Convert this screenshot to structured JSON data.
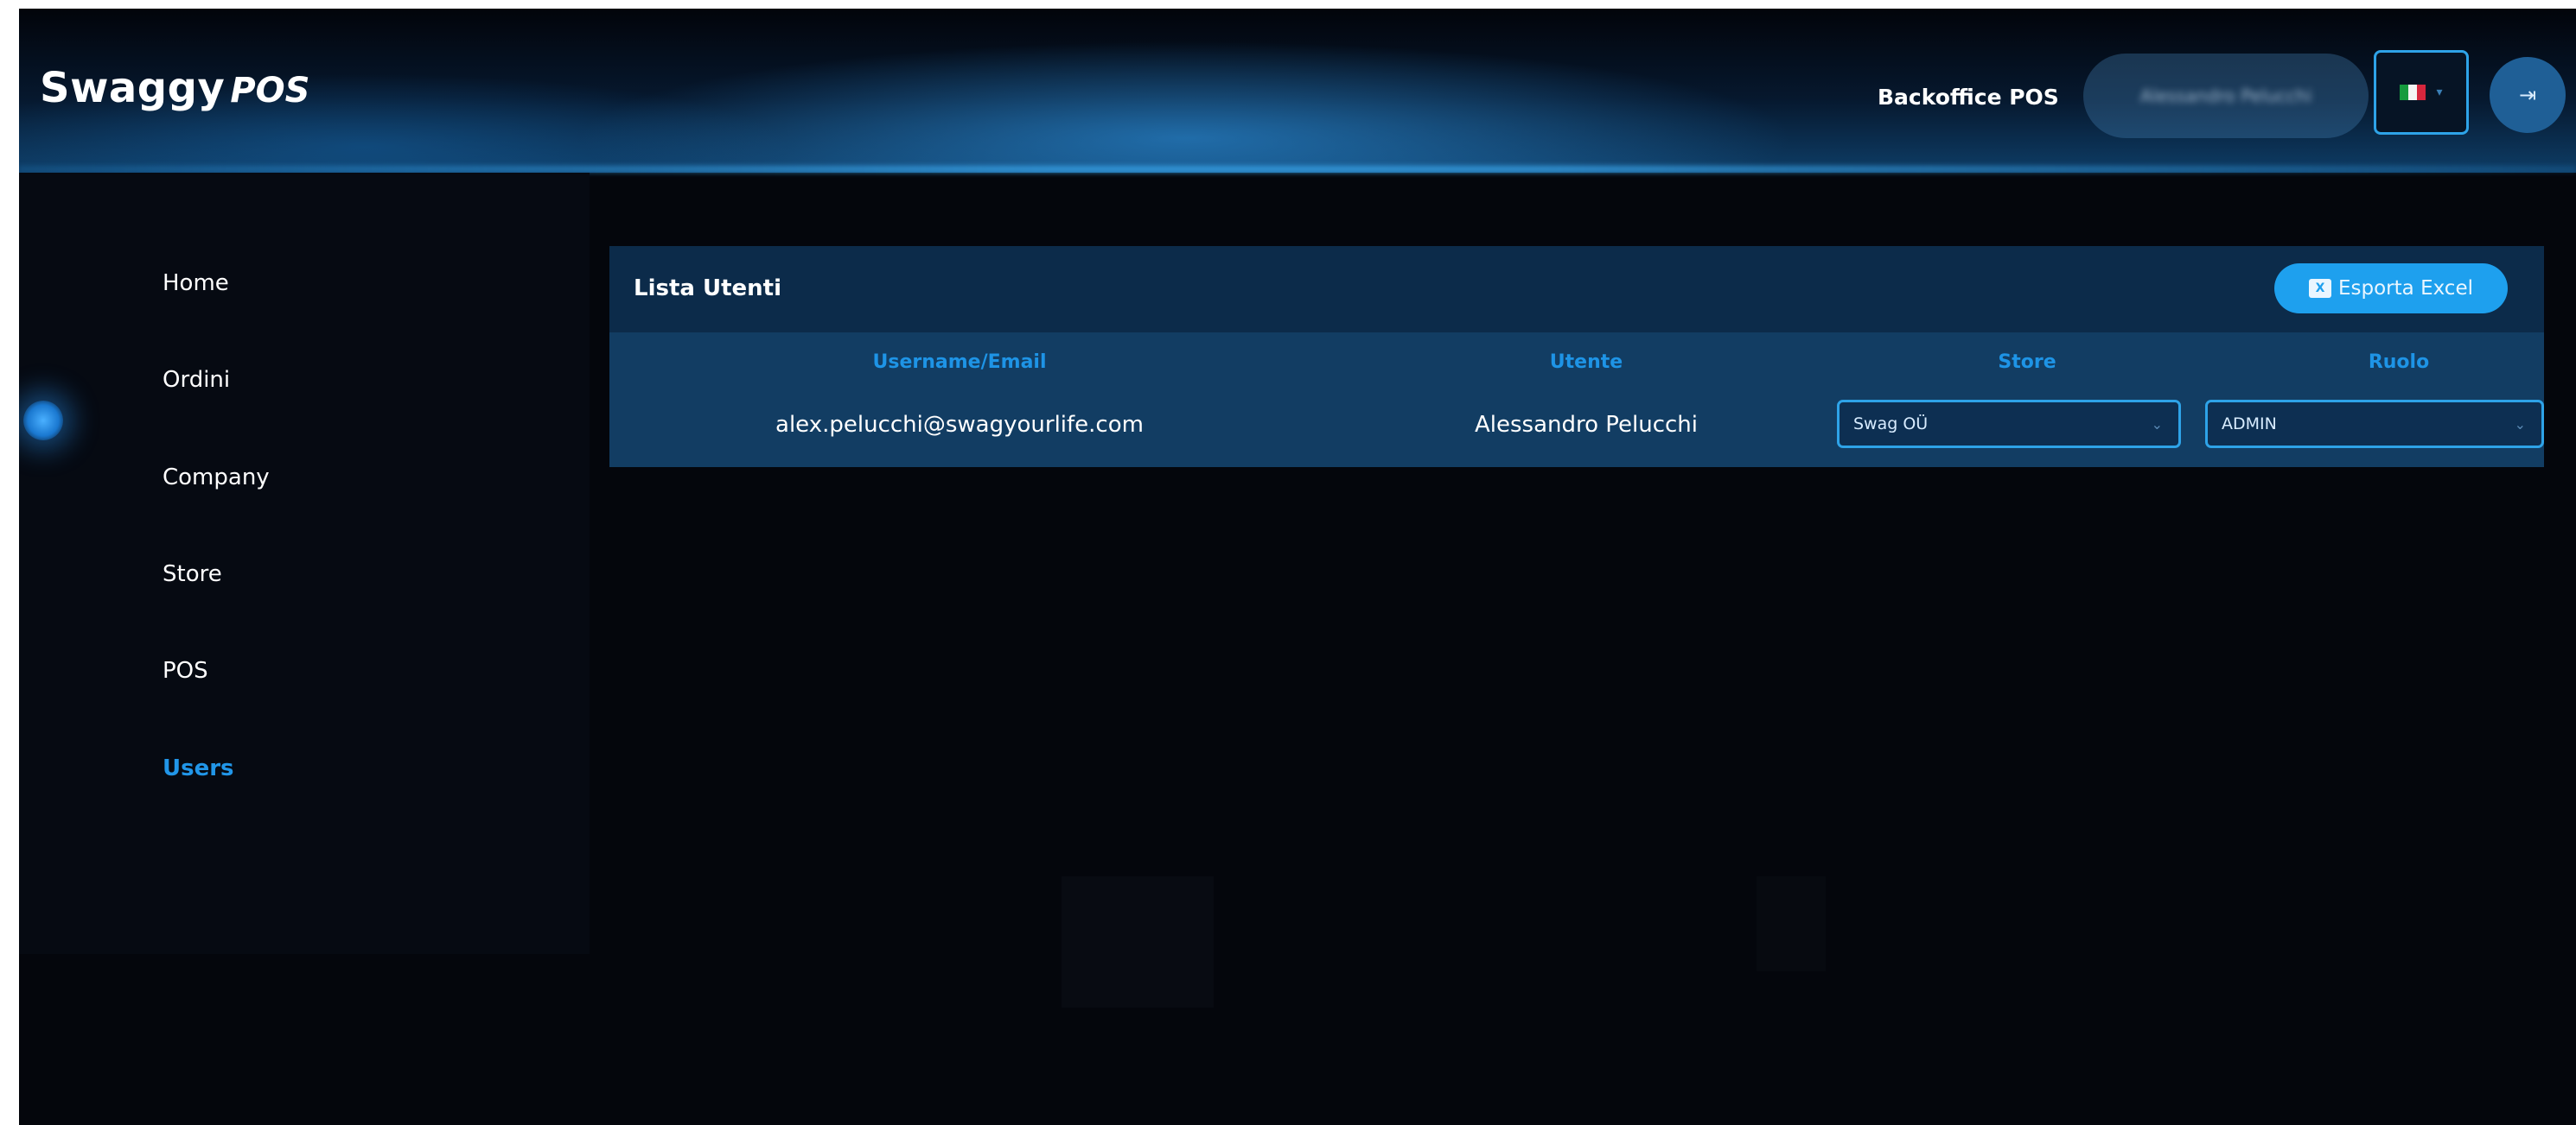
{
  "header": {
    "logo_main": "Swaggy",
    "logo_sub": "POS",
    "brand_label": "Backoffice POS",
    "user_name": "Alessandro Pelucchi",
    "language_flag": "italy-flag-icon",
    "logout_icon": "logout-icon"
  },
  "sidebar": {
    "items": [
      {
        "label": "Home"
      },
      {
        "label": "Ordini"
      },
      {
        "label": "Company"
      },
      {
        "label": "Store"
      },
      {
        "label": "POS"
      },
      {
        "label": "Users",
        "active": true
      }
    ]
  },
  "users_card": {
    "title": "Lista Utenti",
    "export_label": "Esporta Excel",
    "columns": [
      "Username/Email",
      "Utente",
      "Store",
      "Ruolo"
    ],
    "rows": [
      {
        "email": "alex.pelucchi@swagyourlife.com",
        "utente": "Alessandro Pelucchi",
        "store": "Swag OÜ",
        "ruolo": "ADMIN"
      }
    ]
  },
  "colors": {
    "accent": "#1ea0ee",
    "background": "#04060c",
    "card": "#0c2b4a",
    "table": "#123d63"
  }
}
